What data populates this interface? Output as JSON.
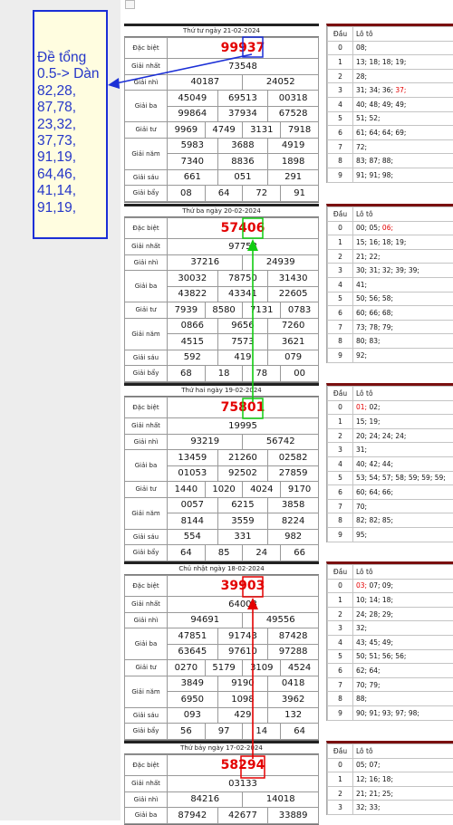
{
  "note": {
    "text": "Đề tổng\n0.5-> Dàn\n82,28,\n87,78,\n23,32,\n37,73,\n91,19,\n64,46,\n41,14,\n91,19,"
  },
  "labels": {
    "special": "Đặc biệt",
    "first": "Giải nhất",
    "second": "Giải nhì",
    "third": "Giải ba",
    "fourth": "Giải tư",
    "fifth": "Giải năm",
    "sixth": "Giải sáu",
    "seventh": "Giải bẩy",
    "head": "Đầu",
    "loto": "Lô tô"
  },
  "days": [
    {
      "date": "Thứ tư ngày 21-02-2024",
      "special": "99937",
      "first": "73548",
      "second": [
        "40187",
        "24052"
      ],
      "third": [
        [
          "45049",
          "69513",
          "00318"
        ],
        [
          "99864",
          "37934",
          "67528"
        ]
      ],
      "fourth": [
        "9969",
        "4749",
        "3131",
        "7918"
      ],
      "fifth": [
        [
          "5983",
          "3688",
          "4919"
        ],
        [
          "7340",
          "8836",
          "1898"
        ]
      ],
      "sixth": [
        "661",
        "051",
        "291"
      ],
      "seventh": [
        "08",
        "64",
        "72",
        "91"
      ],
      "loto": [
        {
          "h": "0",
          "v": "08;"
        },
        {
          "h": "1",
          "v": "13; 18; 18; 19;"
        },
        {
          "h": "2",
          "v": "28;"
        },
        {
          "h": "3",
          "v": "31; 34; 36; ",
          "hl": "37;"
        },
        {
          "h": "4",
          "v": "40; 48; 49; 49;"
        },
        {
          "h": "5",
          "v": "51; 52;"
        },
        {
          "h": "6",
          "v": "61; 64; 64; 69;"
        },
        {
          "h": "7",
          "v": "72;"
        },
        {
          "h": "8",
          "v": "83; 87; 88;"
        },
        {
          "h": "9",
          "v": "91; 91; 98;"
        }
      ]
    },
    {
      "date": "Thứ ba ngày 20-02-2024",
      "special": "57406",
      "first": "97758",
      "second": [
        "37216",
        "24939"
      ],
      "third": [
        [
          "30032",
          "78750",
          "31430"
        ],
        [
          "43822",
          "43341",
          "22605"
        ]
      ],
      "fourth": [
        "7939",
        "8580",
        "7131",
        "0783"
      ],
      "fifth": [
        [
          "0866",
          "9656",
          "7260"
        ],
        [
          "4515",
          "7573",
          "3621"
        ]
      ],
      "sixth": [
        "592",
        "419",
        "079"
      ],
      "seventh": [
        "68",
        "18",
        "78",
        "00"
      ],
      "loto": [
        {
          "h": "0",
          "v": "00; 05; ",
          "hl": "06;"
        },
        {
          "h": "1",
          "v": "15; 16; 18; 19;"
        },
        {
          "h": "2",
          "v": "21; 22;"
        },
        {
          "h": "3",
          "v": "30; 31; 32; 39; 39;"
        },
        {
          "h": "4",
          "v": "41;"
        },
        {
          "h": "5",
          "v": "50; 56; 58;"
        },
        {
          "h": "6",
          "v": "60; 66; 68;"
        },
        {
          "h": "7",
          "v": "73; 78; 79;"
        },
        {
          "h": "8",
          "v": "80; 83;"
        },
        {
          "h": "9",
          "v": "92;"
        }
      ]
    },
    {
      "date": "Thứ hai ngày 19-02-2024",
      "special": "75801",
      "first": "19995",
      "second": [
        "93219",
        "56742"
      ],
      "third": [
        [
          "13459",
          "21260",
          "02582"
        ],
        [
          "01053",
          "92502",
          "27859"
        ]
      ],
      "fourth": [
        "1440",
        "1020",
        "4024",
        "9170"
      ],
      "fifth": [
        [
          "0057",
          "6215",
          "3858"
        ],
        [
          "8144",
          "3559",
          "8224"
        ]
      ],
      "sixth": [
        "554",
        "331",
        "982"
      ],
      "seventh": [
        "64",
        "85",
        "24",
        "66"
      ],
      "loto": [
        {
          "h": "0",
          "v": "",
          "hl": "01;",
          "v2": " 02;"
        },
        {
          "h": "1",
          "v": "15; 19;"
        },
        {
          "h": "2",
          "v": "20; 24; 24; 24;"
        },
        {
          "h": "3",
          "v": "31;"
        },
        {
          "h": "4",
          "v": "40; 42; 44;"
        },
        {
          "h": "5",
          "v": "53; 54; 57; 58; 59; 59; 59;"
        },
        {
          "h": "6",
          "v": "60; 64; 66;"
        },
        {
          "h": "7",
          "v": "70;"
        },
        {
          "h": "8",
          "v": "82; 82; 85;"
        },
        {
          "h": "9",
          "v": "95;"
        }
      ]
    },
    {
      "date": "Chủ nhật ngày 18-02-2024",
      "special": "39903",
      "first": "64003",
      "second": [
        "94691",
        "49556"
      ],
      "third": [
        [
          "47851",
          "91743",
          "87428"
        ],
        [
          "63645",
          "97610",
          "97288"
        ]
      ],
      "fourth": [
        "0270",
        "5179",
        "3109",
        "4524"
      ],
      "fifth": [
        [
          "3849",
          "9190",
          "0418"
        ],
        [
          "6950",
          "1098",
          "3962"
        ]
      ],
      "sixth": [
        "093",
        "429",
        "132"
      ],
      "seventh": [
        "56",
        "97",
        "14",
        "64"
      ],
      "loto": [
        {
          "h": "0",
          "v": "",
          "hl": "03;",
          "v2": " 07; 09;"
        },
        {
          "h": "1",
          "v": "10; 14; 18;"
        },
        {
          "h": "2",
          "v": "24; 28; 29;"
        },
        {
          "h": "3",
          "v": "32;"
        },
        {
          "h": "4",
          "v": "43; 45; 49;"
        },
        {
          "h": "5",
          "v": "50; 51; 56; 56;"
        },
        {
          "h": "6",
          "v": "62; 64;"
        },
        {
          "h": "7",
          "v": "70; 79;"
        },
        {
          "h": "8",
          "v": "88;"
        },
        {
          "h": "9",
          "v": "90; 91; 93; 97; 98;"
        }
      ]
    },
    {
      "date": "Thứ bảy ngày 17-02-2024",
      "special": "58294",
      "first": "03133",
      "second": [
        "84216",
        "14018"
      ],
      "third": [
        [
          "87942",
          "42677",
          "33889"
        ]
      ],
      "loto": [
        {
          "h": "0",
          "v": "05; 07;"
        },
        {
          "h": "1",
          "v": "12; 16; 18;"
        },
        {
          "h": "2",
          "v": "21; 21; 25;"
        },
        {
          "h": "3",
          "v": "32; 33;"
        }
      ]
    }
  ]
}
